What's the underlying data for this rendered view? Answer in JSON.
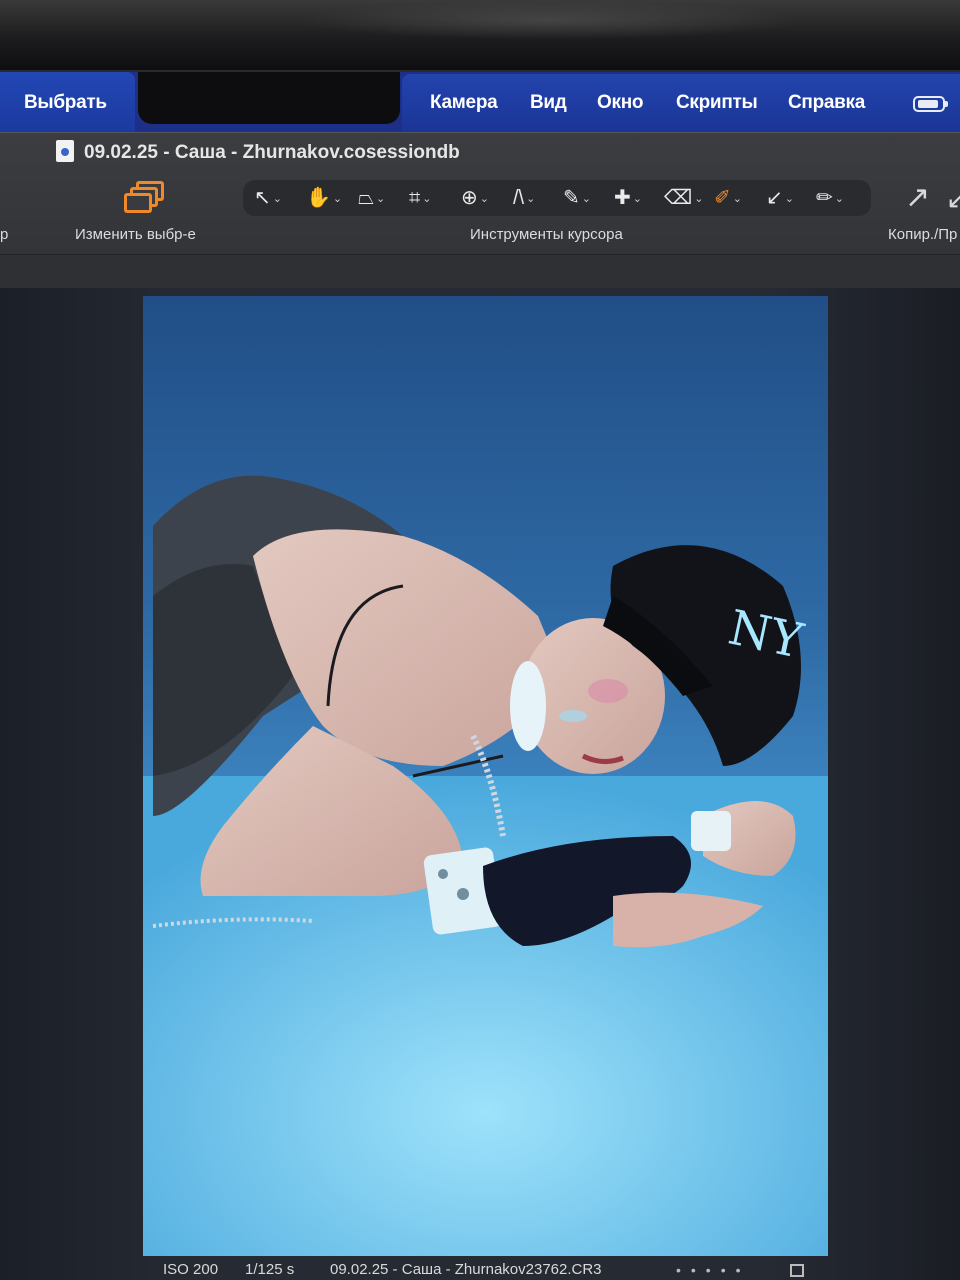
{
  "menubar": {
    "app_menu": "Выбрать",
    "items": [
      "Камера",
      "Вид",
      "Окно",
      "Скрипты",
      "Справка"
    ]
  },
  "window": {
    "title": "09.02.25 - Саша - Zhurnakov.cosessiondb"
  },
  "toolbar": {
    "left_clipped_label": "р",
    "change_selection_label": "Изменить выбр-е",
    "cursor_tools_label": "Инструменты курсора",
    "copy_paste_label": "Копир./Пр",
    "tools": [
      {
        "icon": "select-arrow-icon",
        "glyph": "↖"
      },
      {
        "icon": "hand-pan-icon",
        "glyph": "✋"
      },
      {
        "icon": "keystone-icon",
        "glyph": "⏢"
      },
      {
        "icon": "crop-icon",
        "glyph": "⌗"
      },
      {
        "icon": "rotate-icon",
        "glyph": "⊕"
      },
      {
        "icon": "straighten-icon",
        "glyph": "/\\"
      },
      {
        "icon": "brush-icon",
        "glyph": "✎"
      },
      {
        "icon": "heal-icon",
        "glyph": "✚"
      },
      {
        "icon": "eraser-icon",
        "glyph": "⌫"
      },
      {
        "icon": "color-picker-icon",
        "glyph": "✐"
      },
      {
        "icon": "apply-arrow-icon",
        "glyph": "↙"
      },
      {
        "icon": "pen-icon",
        "glyph": "✏"
      }
    ],
    "accent_color": "#f0892a"
  },
  "status": {
    "iso": "ISO 200",
    "shutter": "1/125 s",
    "filename": "09.02.25 - Саша - Zhurnakov23762.CR3"
  }
}
